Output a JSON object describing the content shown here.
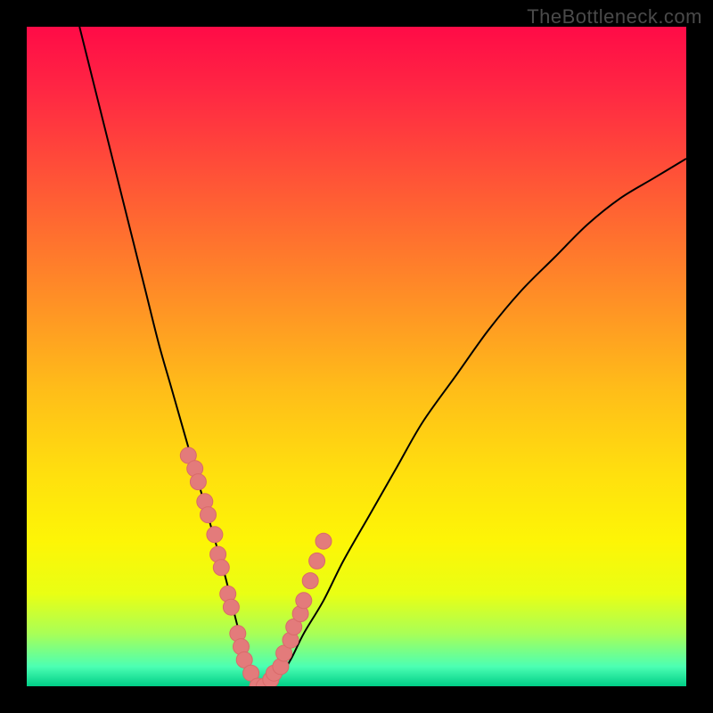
{
  "watermark": "TheBottleneck.com",
  "colors": {
    "gradient_stops": [
      {
        "offset": 0.0,
        "color": "#ff0b47"
      },
      {
        "offset": 0.1,
        "color": "#ff2843"
      },
      {
        "offset": 0.25,
        "color": "#ff5a35"
      },
      {
        "offset": 0.4,
        "color": "#ff8b27"
      },
      {
        "offset": 0.55,
        "color": "#ffbd19"
      },
      {
        "offset": 0.68,
        "color": "#ffe00e"
      },
      {
        "offset": 0.78,
        "color": "#fdf506"
      },
      {
        "offset": 0.86,
        "color": "#e9ff14"
      },
      {
        "offset": 0.92,
        "color": "#a9ff56"
      },
      {
        "offset": 0.97,
        "color": "#4cffb3"
      },
      {
        "offset": 1.0,
        "color": "#00ce87"
      }
    ],
    "curve": "#000000",
    "dots": "#e37b7b",
    "dot_stroke": "#d96a6a"
  },
  "chart_data": {
    "type": "line",
    "title": "",
    "xlabel": "",
    "ylabel": "",
    "xlim": [
      0,
      100
    ],
    "ylim": [
      0,
      100
    ],
    "series": [
      {
        "name": "bottleneck-curve",
        "x": [
          8,
          10,
          12,
          14,
          16,
          18,
          20,
          22,
          24,
          26,
          28,
          30,
          31,
          32,
          33,
          34,
          35,
          36,
          38,
          40,
          42,
          45,
          48,
          52,
          56,
          60,
          65,
          70,
          75,
          80,
          85,
          90,
          95,
          100
        ],
        "y": [
          100,
          92,
          84,
          76,
          68,
          60,
          52,
          45,
          38,
          31,
          24,
          17,
          13,
          9,
          6,
          3,
          1,
          0,
          1,
          4,
          8,
          13,
          19,
          26,
          33,
          40,
          47,
          54,
          60,
          65,
          70,
          74,
          77,
          80
        ]
      }
    ],
    "scatter_points": {
      "name": "highlighted-range",
      "x": [
        24.5,
        25.5,
        26.0,
        27.0,
        27.5,
        28.5,
        29.0,
        29.5,
        30.5,
        31.0,
        32.0,
        32.5,
        33.0,
        34.0,
        35.0,
        36.0,
        37.0,
        37.5,
        38.5,
        39.0,
        40.0,
        40.5,
        41.5,
        42.0,
        43.0,
        44.0,
        45.0
      ],
      "y": [
        35,
        33,
        31,
        28,
        26,
        23,
        20,
        18,
        14,
        12,
        8,
        6,
        4,
        2,
        0,
        0,
        1,
        2,
        3,
        5,
        7,
        9,
        11,
        13,
        16,
        19,
        22
      ]
    }
  }
}
